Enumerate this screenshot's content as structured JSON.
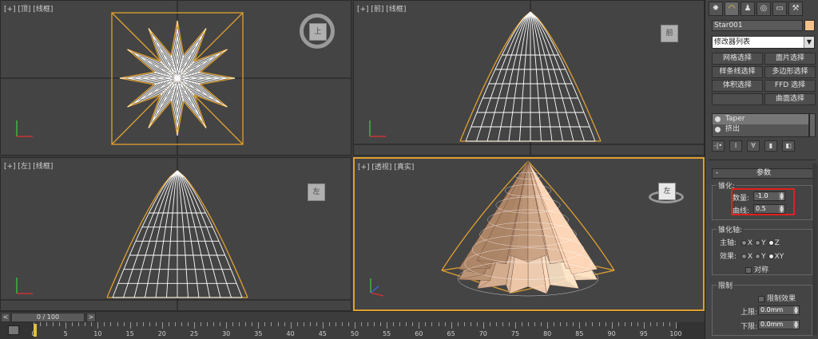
{
  "viewports": {
    "top": {
      "label": "[+] [顶] [线框]",
      "cube": "上"
    },
    "front": {
      "label": "[+] [前] [线框]",
      "cube": "前"
    },
    "left": {
      "label": "[+] [左] [线框]",
      "cube": "左"
    },
    "perspective": {
      "label": "[+] [透视] [真实]",
      "cube": "左"
    }
  },
  "timeline": {
    "frame_display": "0 / 100",
    "prev": "<",
    "next": ">",
    "ticks": [
      "0",
      "5",
      "10",
      "15",
      "20",
      "25",
      "30",
      "35",
      "40",
      "45",
      "50",
      "55",
      "60",
      "65",
      "70",
      "75",
      "80",
      "85",
      "90",
      "95",
      "100"
    ]
  },
  "panel": {
    "tabs": [
      {
        "icon": "sun-icon",
        "glyph": "✸"
      },
      {
        "icon": "curve-icon",
        "glyph": "◠"
      },
      {
        "icon": "hierarchy-icon",
        "glyph": "♟"
      },
      {
        "icon": "motion-icon",
        "glyph": "◎"
      },
      {
        "icon": "display-icon",
        "glyph": "▭"
      },
      {
        "icon": "utilities-icon",
        "glyph": "⚒"
      }
    ],
    "object_name": "Star001",
    "object_color": "#f4c08a",
    "modifier_list": "修改器列表",
    "buttons": [
      "网格选择",
      "面片选择",
      "样条线选择",
      "多边形选择",
      "体积选择",
      "FFD 选择",
      "",
      "曲面选择"
    ],
    "stack": [
      {
        "label": "Taper",
        "selected": true
      },
      {
        "label": "挤出",
        "selected": false
      }
    ],
    "stack_tools": [
      "-|•",
      "I",
      "∀",
      "▮",
      "◧"
    ],
    "rollout_title": "参数",
    "rollout_minus": "-",
    "taper_group": "锥化:",
    "amount_label": "数量:",
    "amount_value": "-1.0",
    "curve_label": "曲线:",
    "curve_value": "0.5",
    "axis_group": "锥化轴:",
    "primary_label": "主轴:",
    "primary_options": [
      "X",
      "Y",
      "Z"
    ],
    "primary_selected": "Z",
    "effect_label": "效果:",
    "effect_options": [
      "X",
      "Y",
      "XY"
    ],
    "effect_selected": "XY",
    "symmetry_label": "对称",
    "limit_group": "限制",
    "limit_effect_label": "限制效果",
    "upper_label": "上限:",
    "upper_value": "0.0mm",
    "lower_label": "下限:",
    "lower_value": "0.0mm"
  }
}
